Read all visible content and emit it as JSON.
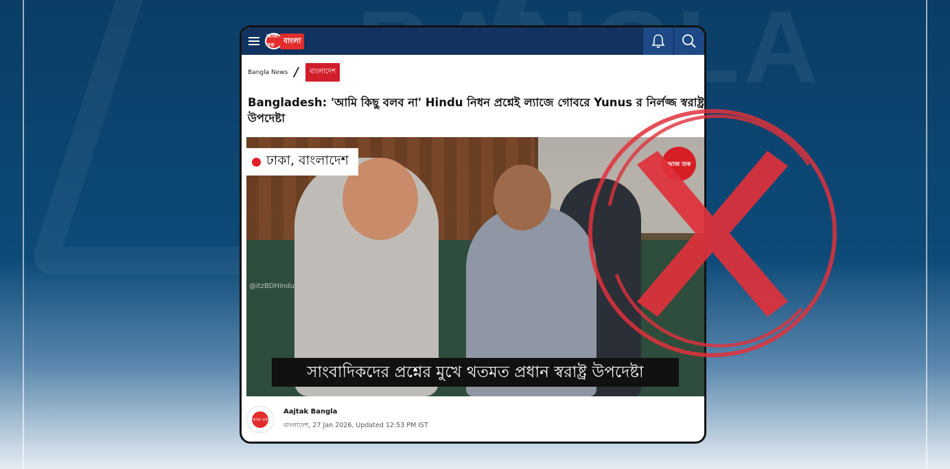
{
  "background": {
    "watermark_text": "BANGLA",
    "accent_color": "#0d4a78"
  },
  "header": {
    "logo_badge": "আজ তক",
    "logo_text": "বাংলা",
    "menu_icon": "hamburger-menu-icon",
    "notification_icon": "bell-icon",
    "search_icon": "search-icon",
    "bar_color": "#12335f"
  },
  "breadcrumb": {
    "home": "Bangla News",
    "separator": "/",
    "category": "বাংলাদেশ"
  },
  "article": {
    "headline": "Bangladesh: 'আমি কিছু বলব না' Hindu নিধন প্রশ্নেই ল্যাজে গোবরে Yunus র নির্লজ্জ স্বরাষ্ট্র উপদেষ্টা",
    "video_location": "ঢাকা, বাংলাদেশ",
    "video_watermark": "@itzBDHindu",
    "video_caption": "সাংবাদিকদের প্রশ্নের মুখে থতমত  প্রধান স্বরাষ্ট্র উপদেষ্টা",
    "video_logo": "আজ তক",
    "author_name": "Aajtak Bangla",
    "byline": "বাংলাদেশ, 27 Jan 2026, Updated 12:53 PM IST"
  },
  "overlay": {
    "icon": "red-cross-icon",
    "color": "#e0313b"
  }
}
